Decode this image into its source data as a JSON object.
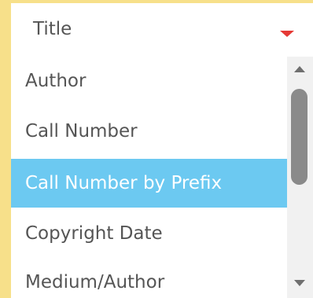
{
  "select": {
    "value": "Title",
    "caret_color": "#e53935",
    "border_color": "#f7e08a",
    "icon": "caret-down-icon"
  },
  "options": [
    {
      "label": "Author",
      "selected": false
    },
    {
      "label": "Call Number",
      "selected": false
    },
    {
      "label": "Call Number by Prefix",
      "selected": true
    },
    {
      "label": "Copyright Date",
      "selected": false
    },
    {
      "label": "Medium/Author",
      "selected": false
    }
  ],
  "highlight_color": "#6cc9f1"
}
